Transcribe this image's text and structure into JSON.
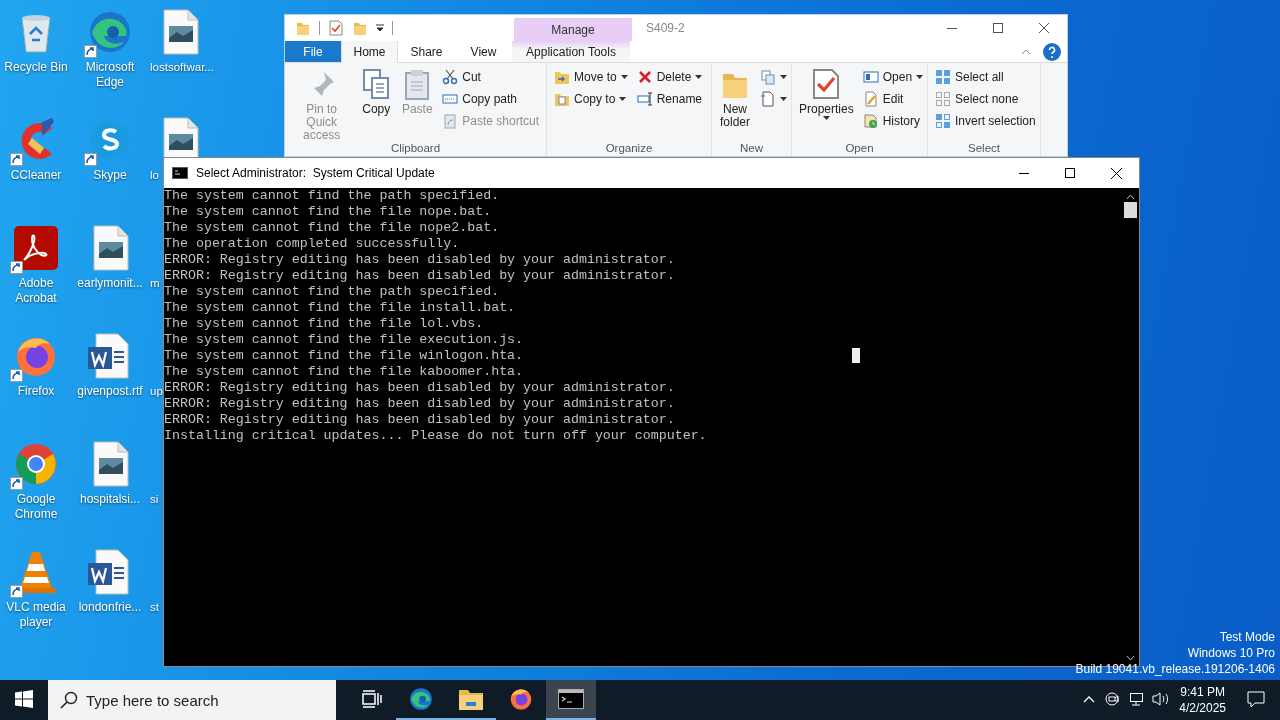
{
  "desktop": {
    "icon_columns": [
      {
        "icons": [
          {
            "label": "Recycle Bin",
            "kind": "recycle",
            "shortcut": false
          },
          {
            "label": "CCleaner",
            "kind": "ccleaner",
            "shortcut": true
          },
          {
            "label": "Adobe Acrobat",
            "kind": "acrobat",
            "shortcut": true
          },
          {
            "label": "Firefox",
            "kind": "firefox",
            "shortcut": true
          },
          {
            "label": "Google Chrome",
            "kind": "chrome",
            "shortcut": true
          },
          {
            "label": "VLC media player",
            "kind": "vlc",
            "shortcut": true
          }
        ]
      },
      {
        "icons": [
          {
            "label": "Microsoft Edge",
            "kind": "edge",
            "shortcut": true
          },
          {
            "label": "Skype",
            "kind": "skype",
            "shortcut": true
          },
          {
            "label": "earlymonit...",
            "kind": "image",
            "shortcut": false
          },
          {
            "label": "givenpost.rtf",
            "kind": "word",
            "shortcut": false
          },
          {
            "label": "hospitalsi...",
            "kind": "image",
            "shortcut": false
          },
          {
            "label": "londonfrie...",
            "kind": "word",
            "shortcut": false
          }
        ]
      },
      {
        "icons": [
          {
            "label": "lostsoftwar...",
            "kind": "image",
            "shortcut": false
          },
          {
            "label": "lo",
            "kind": "image",
            "shortcut": false
          },
          {
            "label": "m"
          },
          {
            "label": "up"
          },
          {
            "label": "si"
          },
          {
            "label": "st"
          }
        ]
      }
    ],
    "system_text": [
      "Test Mode",
      "Windows 10 Pro",
      "Build 19041.vb_release.191206-1406"
    ]
  },
  "explorer": {
    "title": "S409-2",
    "context_header": "Manage",
    "tabs": [
      {
        "label": "File",
        "kind": "file",
        "selected": false
      },
      {
        "label": "Home",
        "selected": true
      },
      {
        "label": "Share",
        "selected": false
      },
      {
        "label": "View",
        "selected": false
      },
      {
        "label": "Application Tools",
        "kind": "context",
        "selected": false
      }
    ],
    "groups": [
      {
        "label": "Clipboard",
        "items": [
          {
            "kind": "large",
            "label": "Pin to Quick access",
            "disabled": true,
            "dropdown": false
          },
          {
            "kind": "large",
            "label": "Copy",
            "disabled": false,
            "dropdown": false
          },
          {
            "kind": "large",
            "label": "Paste",
            "disabled": true,
            "dropdown": false
          },
          {
            "kind": "stack",
            "buttons": [
              {
                "label": "Cut",
                "disabled": false,
                "dropdown": false
              },
              {
                "label": "Copy path",
                "disabled": false,
                "dropdown": false
              },
              {
                "label": "Paste shortcut",
                "disabled": true,
                "dropdown": false
              }
            ]
          }
        ]
      },
      {
        "label": "Organize",
        "items": [
          {
            "kind": "stack",
            "buttons": [
              {
                "label": "Move to",
                "disabled": false,
                "dropdown": true
              },
              {
                "label": "Copy to",
                "disabled": false,
                "dropdown": true
              }
            ]
          },
          {
            "kind": "stack",
            "buttons": [
              {
                "label": "Delete",
                "disabled": false,
                "dropdown": true
              },
              {
                "label": "Rename",
                "disabled": false,
                "dropdown": false
              }
            ]
          }
        ]
      },
      {
        "label": "New",
        "items": [
          {
            "kind": "large",
            "label": "New folder",
            "disabled": false,
            "dropdown": false
          },
          {
            "kind": "stack",
            "buttons": [
              {
                "disabled": false,
                "dropdown": true
              },
              {
                "disabled": false,
                "dropdown": true
              }
            ]
          }
        ]
      },
      {
        "label": "Open",
        "items": [
          {
            "kind": "large",
            "label": "Properties",
            "disabled": false,
            "dropdown": true
          },
          {
            "kind": "stack",
            "buttons": [
              {
                "label": "Open",
                "disabled": false,
                "dropdown": true
              },
              {
                "label": "Edit",
                "disabled": false,
                "dropdown": false
              },
              {
                "label": "History",
                "disabled": false,
                "dropdown": false
              }
            ]
          }
        ]
      },
      {
        "label": "Select",
        "items": [
          {
            "kind": "stack",
            "buttons": [
              {
                "label": "Select all",
                "disabled": false,
                "dropdown": false
              },
              {
                "label": "Select none",
                "disabled": false,
                "dropdown": false
              },
              {
                "label": "Invert selection",
                "disabled": false,
                "dropdown": false
              }
            ]
          }
        ]
      }
    ]
  },
  "console": {
    "title": "Select Administrator:  System Critical Update",
    "lines": [
      "The system cannot find the path specified.",
      "The system cannot find the file nope.bat.",
      "The system cannot find the file nope2.bat.",
      "The operation completed successfully.",
      "ERROR: Registry editing has been disabled by your administrator.",
      "ERROR: Registry editing has been disabled by your administrator.",
      "The system cannot find the path specified.",
      "The system cannot find the file install.bat.",
      "The system cannot find the file lol.vbs.",
      "The system cannot find the file execution.js.",
      "The system cannot find the file winlogon.hta.",
      "The system cannot find the file kaboomer.hta.",
      "ERROR: Registry editing has been disabled by your administrator.",
      "ERROR: Registry editing has been disabled by your administrator.",
      "ERROR: Registry editing has been disabled by your administrator.",
      "Installing critical updates... Please do not turn off your computer."
    ]
  },
  "taskbar": {
    "search": {
      "placeholder": "Type here to search"
    },
    "apps": [
      {
        "kind": "taskview",
        "running": false,
        "selected": false
      },
      {
        "kind": "edge",
        "running": true,
        "selected": false
      },
      {
        "kind": "explorer",
        "running": true,
        "selected": false
      },
      {
        "kind": "firefox",
        "running": false,
        "selected": false
      },
      {
        "kind": "console",
        "running": true,
        "selected": true
      }
    ],
    "time": "9:41 PM",
    "date": "4/2/2025"
  }
}
